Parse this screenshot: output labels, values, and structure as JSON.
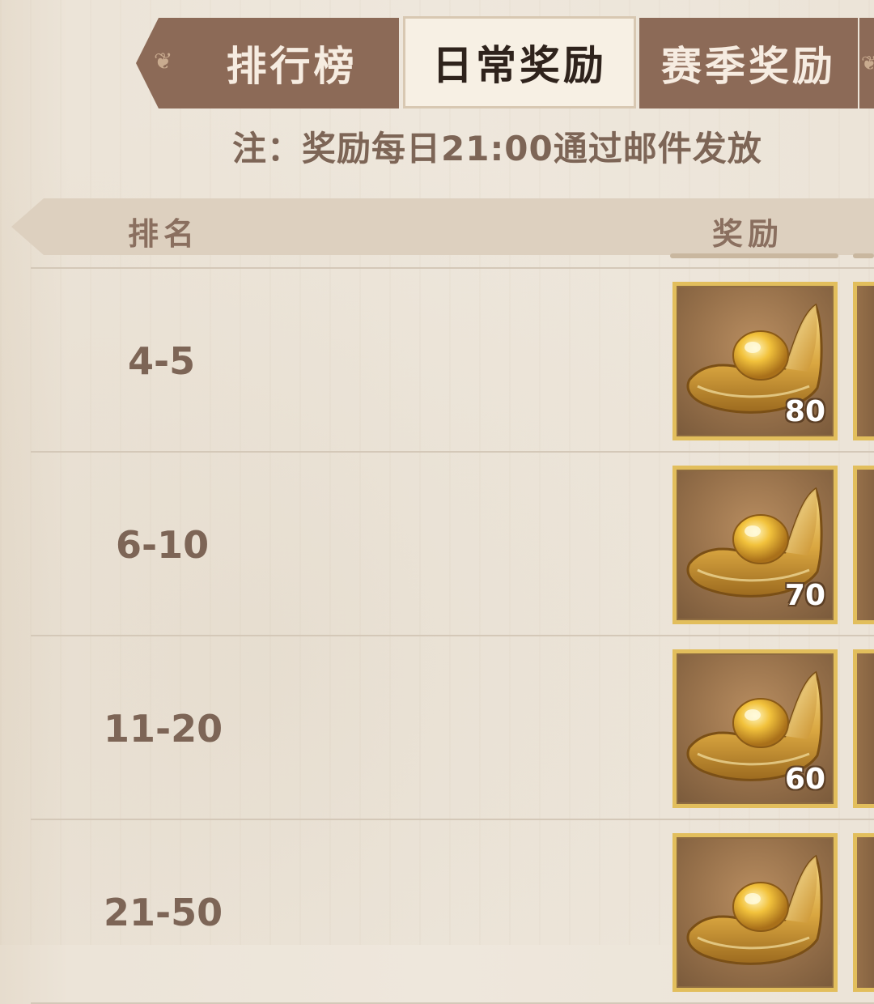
{
  "tabs": [
    {
      "label": "排行榜",
      "active": false
    },
    {
      "label": "日常奖励",
      "active": true
    },
    {
      "label": "赛季奖励",
      "active": false
    }
  ],
  "note": "注：奖励每日21:00通过邮件发放",
  "table": {
    "rank_header": "排名",
    "reward_header": "奖励",
    "rows": [
      {
        "rank": "4-5",
        "reward_icon": "gold-ingot-icon",
        "reward_qty": "80"
      },
      {
        "rank": "6-10",
        "reward_icon": "gold-ingot-icon",
        "reward_qty": "70"
      },
      {
        "rank": "11-20",
        "reward_icon": "gold-ingot-icon",
        "reward_qty": "60"
      },
      {
        "rank": "21-50",
        "reward_icon": "gold-ingot-icon",
        "reward_qty": ""
      }
    ]
  },
  "colors": {
    "tab_inactive": "#8c6a57",
    "tab_active": "#f7f0e4",
    "item_frame": "#e2be5c",
    "text_brown": "#7d6556"
  }
}
